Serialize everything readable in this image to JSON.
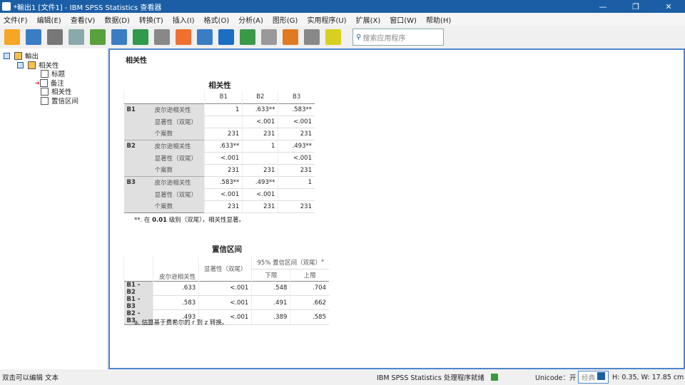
{
  "window": {
    "title": "*輸出1 [文件1] - IBM SPSS Statistics 查看器",
    "controls": [
      "—",
      "❐",
      "✕"
    ]
  },
  "menu": [
    "文件(F)",
    "编辑(E)",
    "查看(V)",
    "数据(D)",
    "转换(T)",
    "插入(I)",
    "格式(O)",
    "分析(A)",
    "图形(G)",
    "实用程序(U)",
    "扩展(X)",
    "窗口(W)",
    "帮助(H)"
  ],
  "toolbar": {
    "icons": [
      "open-icon",
      "save-icon",
      "print-icon",
      "print-preview-icon",
      "export-icon",
      "recall-dialog-icon",
      "undo-icon",
      "redo-icon",
      "goto-data-icon",
      "goto-case-icon",
      "insert-variable-icon",
      "variables-icon",
      "hide-icon",
      "show-icon",
      "designate-window-icon",
      "add-icon"
    ],
    "search_placeholder": "搜索应用程序"
  },
  "nav": {
    "root": "輸出",
    "group": "相关性",
    "items": [
      "标题",
      "备注",
      "相关性",
      "置信区间"
    ]
  },
  "content": {
    "heading": "相关性",
    "corr": {
      "title": "相关性",
      "cols": [
        "B1",
        "B2",
        "B3"
      ],
      "stats": [
        "皮尔逊相关性",
        "显著性（双尾）",
        "个案数"
      ],
      "rows": [
        {
          "var": "B1",
          "values": [
            [
              "1",
              ".633**",
              ".583**"
            ],
            [
              "",
              "<.001",
              "<.001"
            ],
            [
              "231",
              "231",
              "231"
            ]
          ]
        },
        {
          "var": "B2",
          "values": [
            [
              ".633**",
              "1",
              ".493**"
            ],
            [
              "<.001",
              "",
              "<.001"
            ],
            [
              "231",
              "231",
              "231"
            ]
          ]
        },
        {
          "var": "B3",
          "values": [
            [
              ".583**",
              ".493**",
              "1"
            ],
            [
              "<.001",
              "<.001",
              ""
            ],
            [
              "231",
              "231",
              "231"
            ]
          ]
        }
      ],
      "footnote_mark": "**. 在 ",
      "footnote_bold": "0.01",
      "footnote_rest": " 级别（双尾），相关性显著。"
    },
    "ci": {
      "title": "置信区间",
      "col_pearson": "皮尔逊相关性",
      "col_sig": "显著性（双尾）",
      "col_ci": "95% 置信区间（双尾）",
      "col_ci_sup": "a",
      "col_lower": "下限",
      "col_upper": "上限",
      "rows": [
        [
          "B1 - B2",
          ".633",
          "<.001",
          ".548",
          ".704"
        ],
        [
          "B1 - B3",
          ".583",
          "<.001",
          ".491",
          ".662"
        ],
        [
          "B2 - B3",
          ".493",
          "<.001",
          ".389",
          ".585"
        ]
      ],
      "footnote": "a. 估算基于费希尔的 r 到 z 转换。"
    }
  },
  "status": {
    "left": "双击可以编辑 文本",
    "processor": "IBM SPSS Statistics 处理程序就绪",
    "unicode": "Unicode：开",
    "mode": "经典",
    "dims": "H: 0.35, W: 17.85 cm"
  }
}
